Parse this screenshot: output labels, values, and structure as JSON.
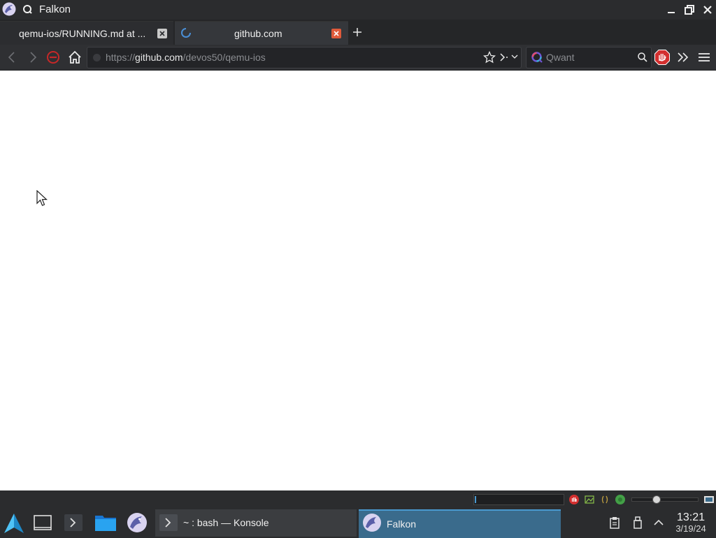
{
  "window": {
    "title": "Falkon"
  },
  "tabs": [
    {
      "label": "qemu-ios/RUNNING.md at ...",
      "active": false
    },
    {
      "label": "github.com",
      "active": true,
      "loading": true
    }
  ],
  "navbar": {
    "url_scheme": "https://",
    "url_host": "github.com",
    "url_path": "/devos50/qemu-ios",
    "search_placeholder": "Qwant"
  },
  "taskbar": {
    "tasks": [
      {
        "label": "~ : bash — Konsole",
        "active": false
      },
      {
        "label": "Falkon",
        "active": true
      }
    ],
    "clock_time": "13:21",
    "clock_date": "3/19/24"
  },
  "colors": {
    "accent": "#3a6b8c",
    "close_active": "#e05a3a",
    "adblock": "#d32f2f"
  },
  "icons": {
    "app": "falkon-icon",
    "pin": "pin-icon",
    "back": "back-icon",
    "forward": "forward-icon",
    "stop": "stop-icon",
    "home": "home-icon",
    "star": "bookmark-star-icon",
    "adblock": "adblock-icon",
    "more": "more-tools-icon",
    "menu": "hamburger-menu-icon"
  }
}
